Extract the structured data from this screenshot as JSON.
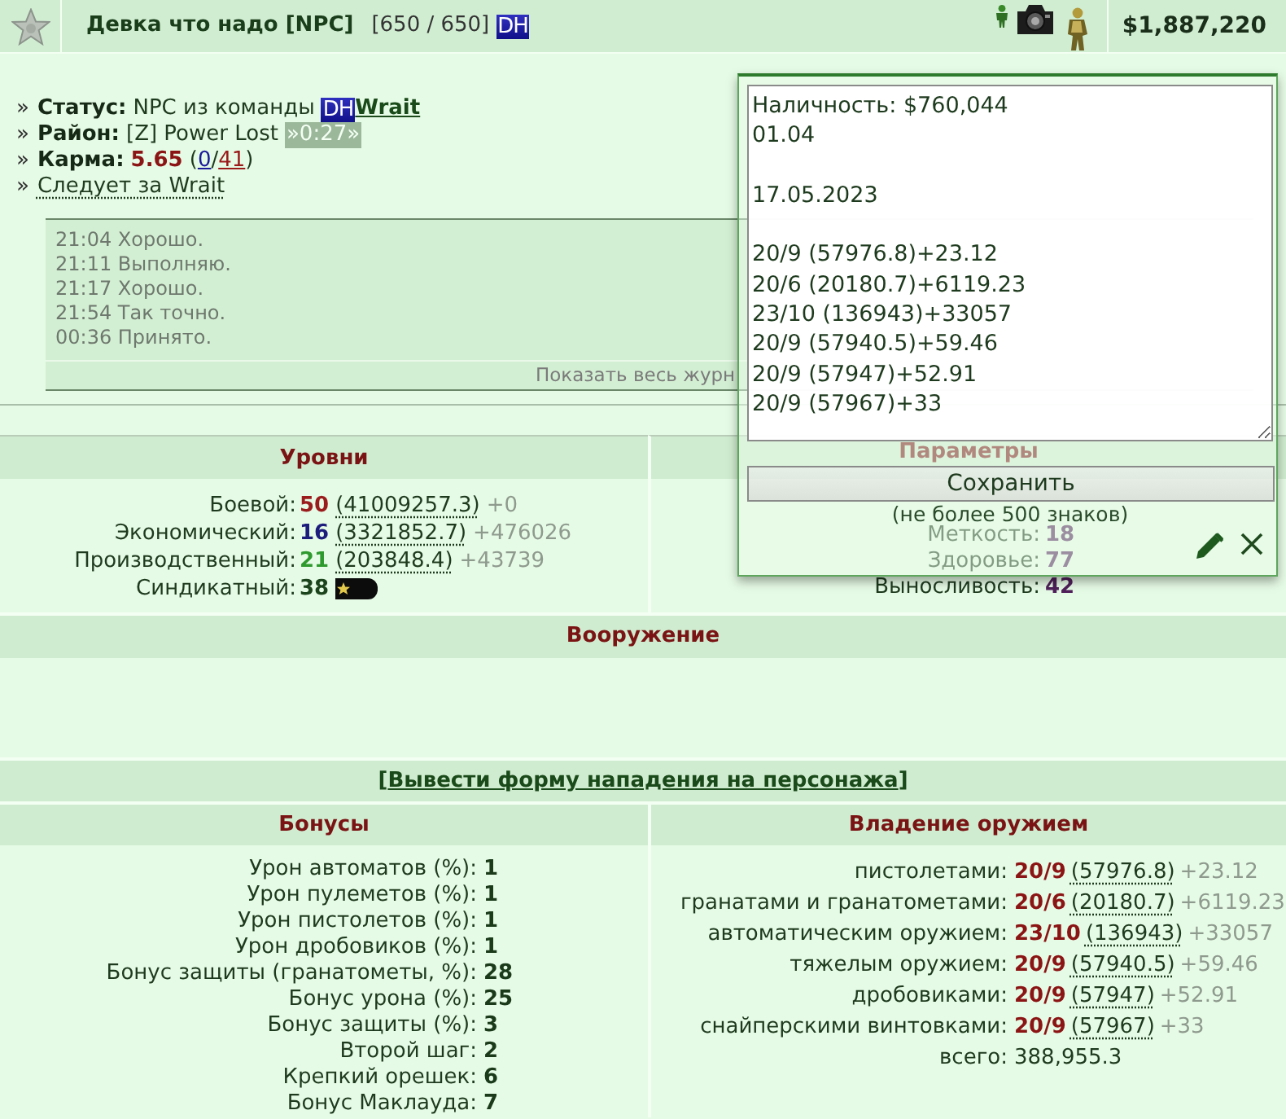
{
  "header": {
    "name": "Девка что надо [NPC]",
    "health": "[650 / 650]",
    "clan_tag": "DH",
    "money": "$1,887,220"
  },
  "status_lines": [
    {
      "kind": "status",
      "bullet": "»",
      "label": "Статус:",
      "text": "NPC из команды",
      "clan_tag": "DH",
      "link": "Wrait"
    },
    {
      "kind": "district",
      "bullet": "»",
      "label": "Район:",
      "text": "[Z] Power Lost",
      "timer": "»0:27»"
    },
    {
      "kind": "karma",
      "bullet": "»",
      "label": "Карма:",
      "value": "5.65",
      "open": "(",
      "positive": "0",
      "separator": "/",
      "negative": "41",
      "close": ")"
    },
    {
      "kind": "following",
      "bullet": "»",
      "text": "Следует за Wrait"
    }
  ],
  "log": {
    "entries": [
      "21:04 Хорошо.",
      "21:11 Выполняю.",
      "21:17 Хорошо.",
      "21:54 Так точно.",
      "00:36 Принято."
    ],
    "footer": "Показать весь журн"
  },
  "levels": {
    "title": "Уровни",
    "rows": [
      {
        "kind": "progress",
        "label": "Боевой:",
        "value": "50",
        "experience": "(41009257.3)",
        "gain": "+0",
        "color": "#9a1c1c"
      },
      {
        "kind": "progress",
        "label": "Экономический:",
        "value": "16",
        "experience": "(3321852.7)",
        "gain": "+476026",
        "color": "#1c1c7c"
      },
      {
        "kind": "progress",
        "label": "Производственный:",
        "value": "21",
        "experience": "(203848.4)",
        "gain": "+43739",
        "color": "#2e9a2e"
      },
      {
        "kind": "badge",
        "label": "Синдикатный:",
        "value": "38",
        "color": "#1c441c"
      }
    ]
  },
  "parameters": {
    "title": "Параметры",
    "rows": [
      {
        "label": "Меткость:",
        "value": "18"
      },
      {
        "label": "Здоровье:",
        "value": "77"
      },
      {
        "label": "Выносливость:",
        "value": "42"
      }
    ]
  },
  "armament": {
    "title": "Вооружение"
  },
  "attack_link": {
    "open": "[",
    "text": "Вывести форму нападения на персонажа",
    "close": "]"
  },
  "bonuses": {
    "title": "Бонусы",
    "rows": [
      {
        "label": "Урон автоматов (%):",
        "value": "1"
      },
      {
        "label": "Урон пулеметов (%):",
        "value": "1"
      },
      {
        "label": "Урон пистолетов (%):",
        "value": "1"
      },
      {
        "label": "Урон дробовиков (%):",
        "value": "1"
      },
      {
        "label": "Бонус защиты (гранатометы, %):",
        "value": "28"
      },
      {
        "label": "Бонус урона (%):",
        "value": "25"
      },
      {
        "label": "Бонус защиты (%):",
        "value": "3"
      },
      {
        "label": "Второй шаг:",
        "value": "2"
      },
      {
        "label": "Крепкий орешек:",
        "value": "6"
      },
      {
        "label": "Бонус Маклауда:",
        "value": "7"
      }
    ]
  },
  "weapon_skills": {
    "title": "Владение оружием",
    "rows": [
      {
        "kind": "skill",
        "label": "пистолетами:",
        "rank": "20/9",
        "experience": "(57976.8)",
        "gain": "+23.12"
      },
      {
        "kind": "skill",
        "label": "гранатами и гранатометами:",
        "rank": "20/6",
        "experience": "(20180.7)",
        "gain": "+6119.23"
      },
      {
        "kind": "skill",
        "label": "автоматическим оружием:",
        "rank": "23/10",
        "experience": "(136943)",
        "gain": "+33057"
      },
      {
        "kind": "skill",
        "label": "тяжелым оружием:",
        "rank": "20/9",
        "experience": "(57940.5)",
        "gain": "+59.46"
      },
      {
        "kind": "skill",
        "label": "дробовиками:",
        "rank": "20/9",
        "experience": "(57947)",
        "gain": "+52.91"
      },
      {
        "kind": "skill",
        "label": "снайперскими винтовками:",
        "rank": "20/9",
        "experience": "(57967)",
        "gain": "+33"
      },
      {
        "kind": "total",
        "label": "всего:",
        "value": "388,955.3"
      }
    ]
  },
  "note_popup": {
    "text": "Наличность: $760,044\n01.04\n\n17.05.2023\n\n20/9 (57976.8)+23.12\n20/6 (20180.7)+6119.23\n23/10 (136943)+33057\n20/9 (57940.5)+59.46\n20/9 (57947)+52.91\n20/9 (57967)+33",
    "save_button": "Сохранить",
    "hint": "(не более 500 знаков)"
  }
}
